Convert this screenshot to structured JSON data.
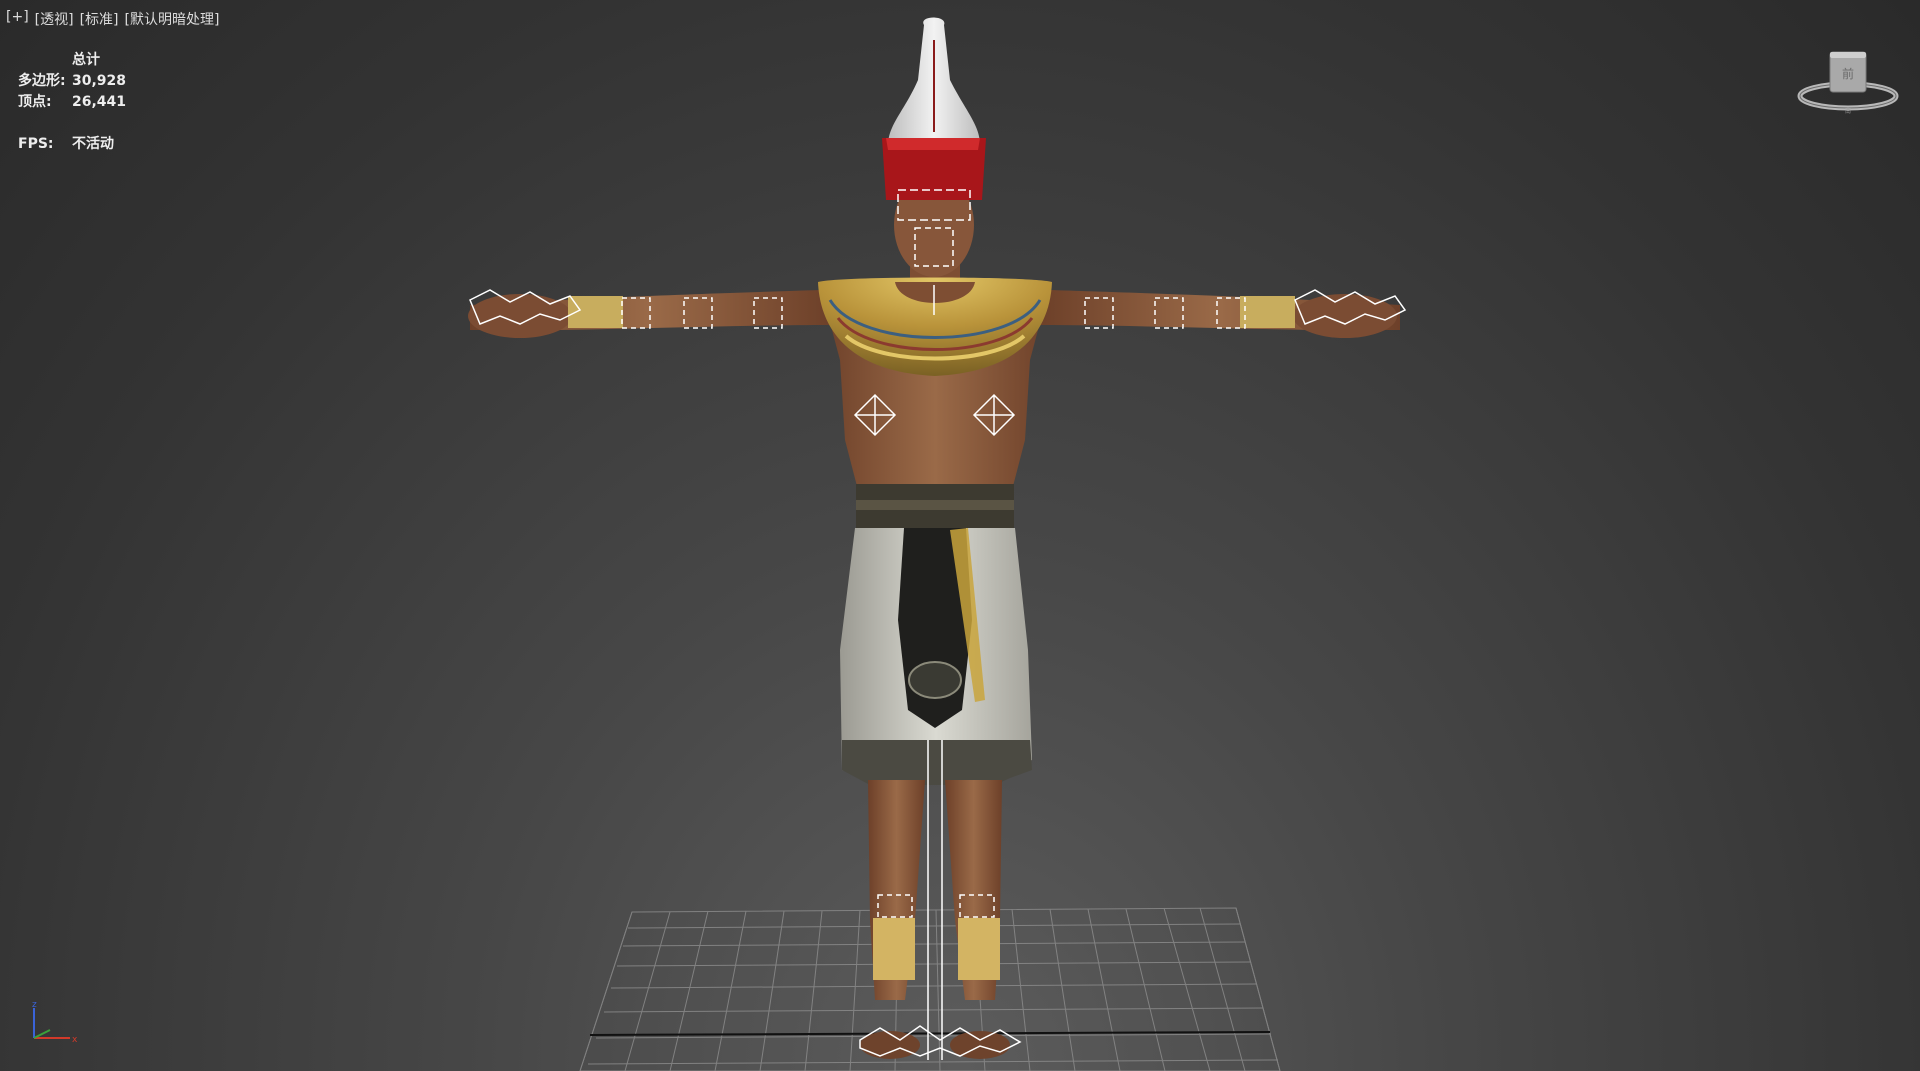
{
  "viewport": {
    "labels": [
      "[+]",
      "[透视]",
      "[标准]",
      "[默认明暗处理]"
    ]
  },
  "stats": {
    "header": "总计",
    "polygons_label": "多边形:",
    "polygons_value": "30,928",
    "vertices_label": "顶点:",
    "vertices_value": "26,441",
    "fps_label": "FPS:",
    "fps_value": "不活动"
  },
  "viewcube": {
    "face_label": "前",
    "compass_label": "南"
  },
  "axis": {
    "z": "z",
    "x": "x"
  },
  "colors": {
    "skin": "#8a5a3c",
    "crown_red": "#b5171b",
    "crown_white": "#e6e6e6",
    "gold": "#c9a43c",
    "kilt": "#cfcfc8",
    "grid": "#9a9a9a"
  }
}
